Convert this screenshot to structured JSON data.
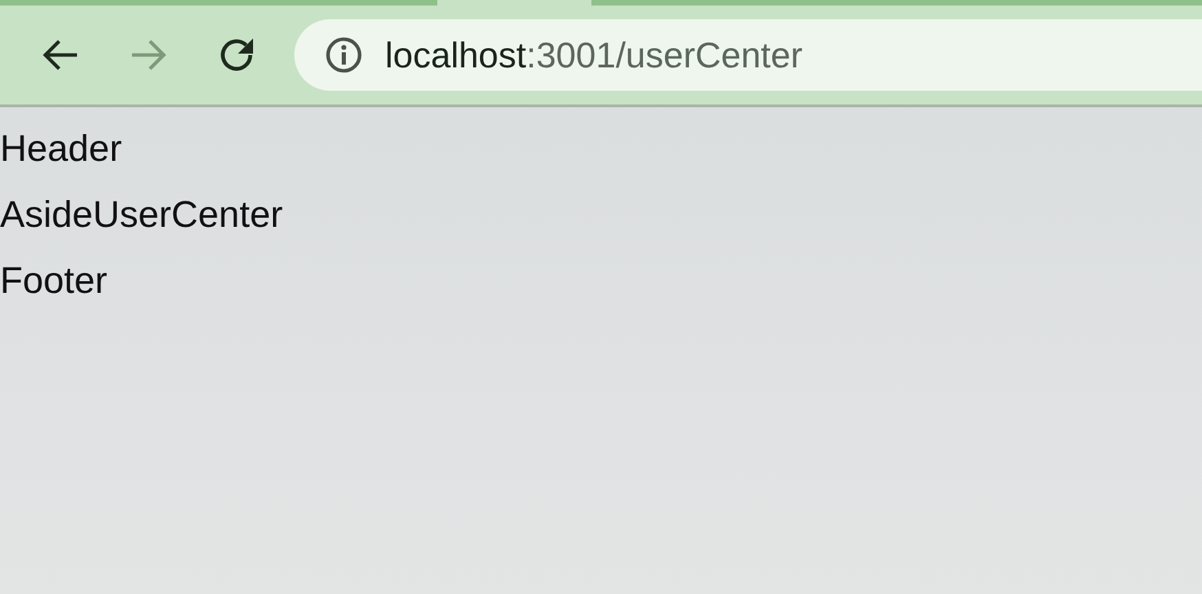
{
  "toolbar": {
    "back": {
      "disabled": false
    },
    "forward": {
      "disabled": true
    },
    "address": {
      "host": "localhost",
      "path": ":3001/userCenter"
    }
  },
  "page": {
    "lines": [
      "Header",
      "AsideUserCenter",
      "Footer"
    ]
  }
}
